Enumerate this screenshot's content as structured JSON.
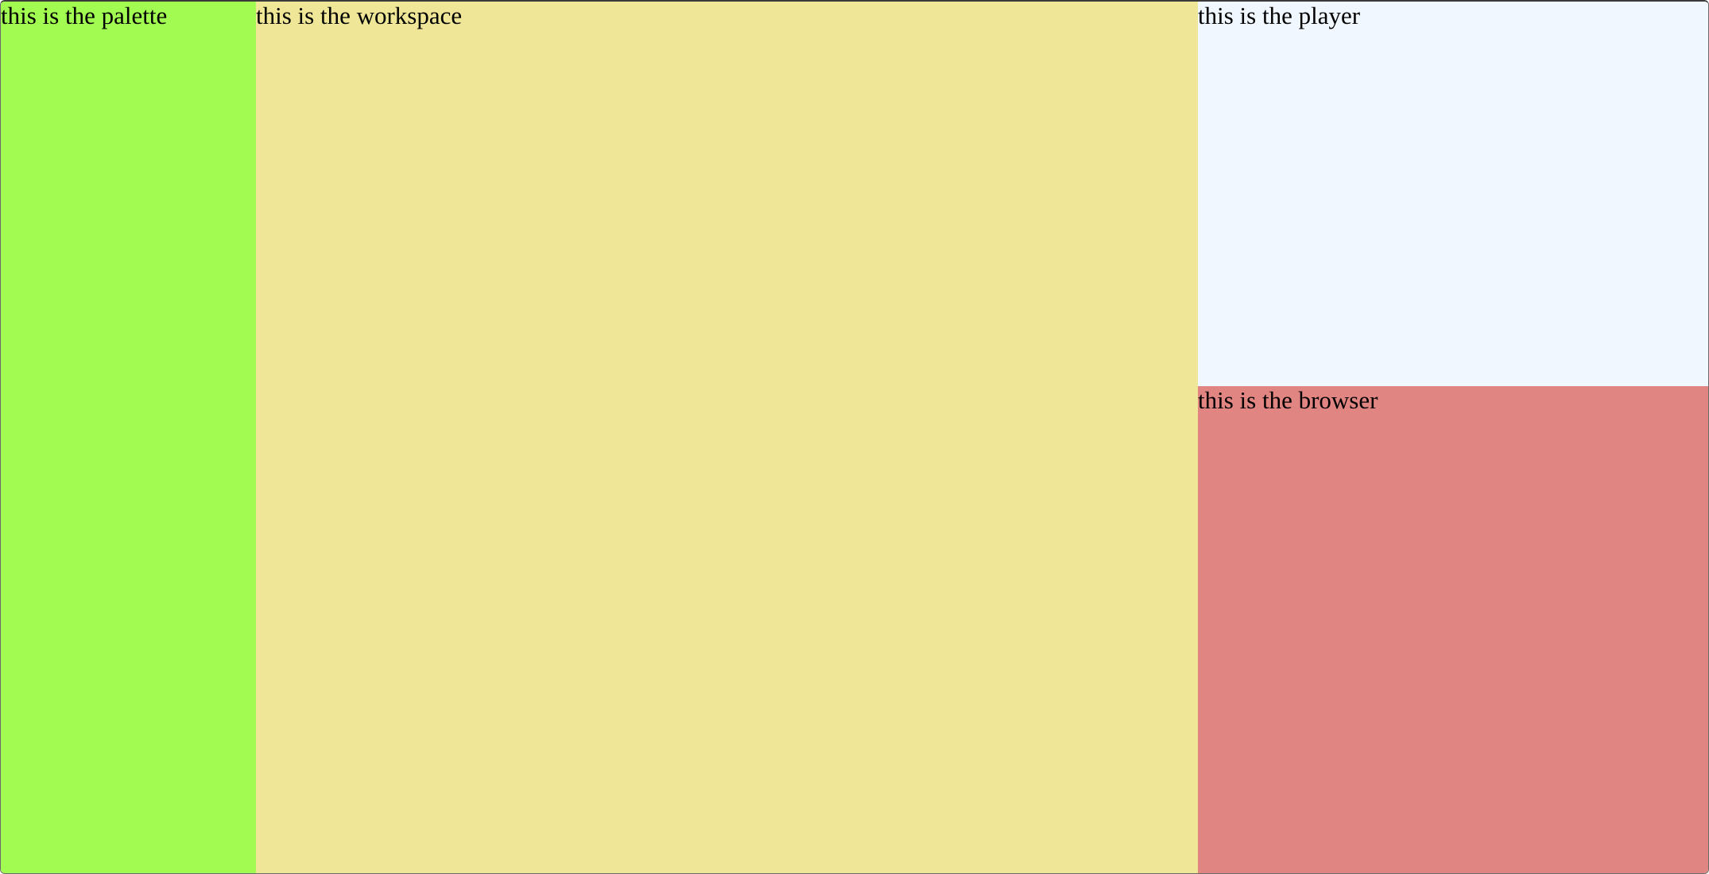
{
  "panes": {
    "palette": {
      "label": "this is the palette",
      "color": "#a2fb50"
    },
    "workspace": {
      "label": "this is the workspace",
      "color": "#efe797"
    },
    "player": {
      "label": "this is the player",
      "color": "#f0f7ff"
    },
    "browser": {
      "label": "this is the browser",
      "color": "#e18582"
    }
  }
}
